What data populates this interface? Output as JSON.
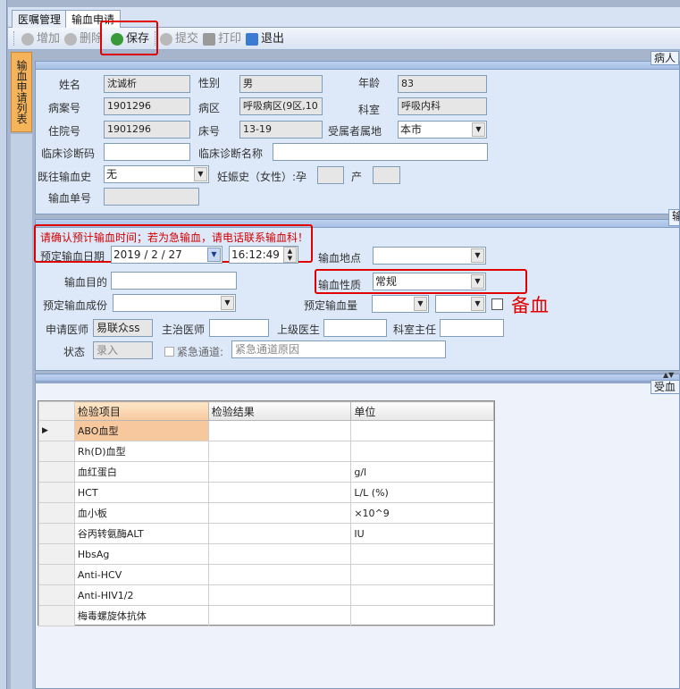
{
  "tabs": [
    "医嘱管理",
    "输血申请"
  ],
  "toolbar": {
    "add": "增加",
    "delete": "删除",
    "save": "保存",
    "submit": "提交",
    "print": "打印",
    "exit": "退出"
  },
  "side_tab": "输血申请列表",
  "patient_panel": {
    "tab_label": "病人",
    "name_label": "姓名",
    "name_value": "沈诚析",
    "gender_label": "性别",
    "gender_value": "男",
    "age_label": "年龄",
    "age_value": "83",
    "record_label": "病案号",
    "record_value": "1901296",
    "ward_label": "病区",
    "ward_value": "呼吸病区(9区,10",
    "dept_label": "科室",
    "dept_value": "呼吸内科",
    "inpatient_label": "住院号",
    "inpatient_value": "1901296",
    "bed_label": "床号",
    "bed_value": "13-19",
    "location_label": "受属者属地",
    "location_value": "本市",
    "diag_code_label": "临床诊断码",
    "diag_name_label": "临床诊断名称",
    "history_label": "既往输血史",
    "history_value": "无",
    "pregnancy_label": "妊娠史（女性）:孕",
    "birth_label": "产",
    "order_no_label": "输血单号"
  },
  "transfusion_panel": {
    "tab_label": "输",
    "warning": "请确认预计输血时间；若为急输血，请电话联系输血科！",
    "date_label": "预定输血日期",
    "date_value": "2019 / 2 / 27",
    "time_value": "16:12:49",
    "place_label": "输血地点",
    "purpose_label": "输血目的",
    "nature_label": "输血性质",
    "nature_value": "常规",
    "component_label": "预定输血成份",
    "amount_label": "预定输血量",
    "annotation": "备血",
    "doctor_label": "申请医师",
    "doctor_value": "易联众ss",
    "attending_label": "主治医师",
    "superior_label": "上级医生",
    "director_label": "科室主任",
    "status_label": "状态",
    "status_value": "录入",
    "emergency_label": "紧急通道:",
    "emergency_placeholder": "紧急通道原因"
  },
  "result_panel": {
    "tab_label": "受血"
  },
  "grid": {
    "headers": [
      "检验项目",
      "检验结果",
      "单位"
    ],
    "rows": [
      {
        "item": "ABO血型",
        "result": "",
        "unit": ""
      },
      {
        "item": "Rh(D)血型",
        "result": "",
        "unit": ""
      },
      {
        "item": "血红蛋白",
        "result": "",
        "unit": "g/l"
      },
      {
        "item": "HCT",
        "result": "",
        "unit": "L/L (%)"
      },
      {
        "item": "血小板",
        "result": "",
        "unit": "×10^9"
      },
      {
        "item": "谷丙转氨酶ALT",
        "result": "",
        "unit": "IU"
      },
      {
        "item": "HbsAg",
        "result": "",
        "unit": ""
      },
      {
        "item": "Anti-HCV",
        "result": "",
        "unit": ""
      },
      {
        "item": "Anti-HIV1/2",
        "result": "",
        "unit": ""
      },
      {
        "item": "梅毒螺旋体抗体",
        "result": "",
        "unit": ""
      }
    ]
  },
  "colors": {
    "annotation_red": "#e00000",
    "selected_cell": "#f7c89e",
    "panel_bg": "#dde8f8"
  }
}
